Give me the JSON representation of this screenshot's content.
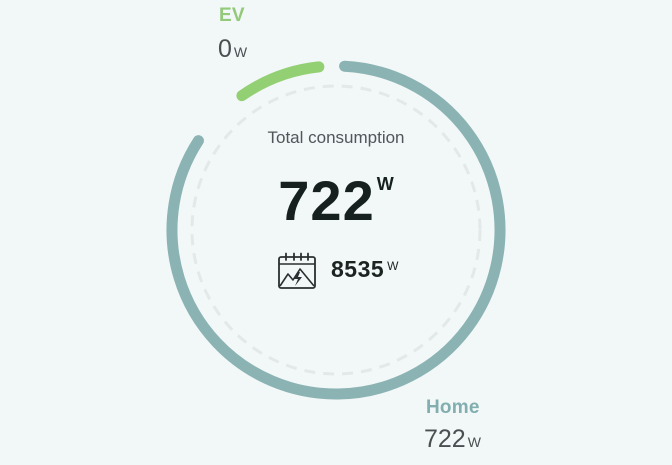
{
  "colors": {
    "background": "#f2f7f7",
    "home_ring": "#8bb3b3",
    "ev_ring": "#93cf73",
    "dashed_track": "#e3e9e9",
    "ev_label": "#93c97a",
    "home_label": "#82aeb0"
  },
  "legend": {
    "ev": {
      "label": "EV",
      "value": "0",
      "unit": "W",
      "share": 0
    },
    "home": {
      "label": "Home",
      "value": "722",
      "unit": "W",
      "share": 1
    }
  },
  "center": {
    "title": "Total consumption",
    "value": "722",
    "unit": "W",
    "production": {
      "icon": "solar-production-calendar-icon",
      "value": "8535",
      "unit": "W"
    }
  }
}
